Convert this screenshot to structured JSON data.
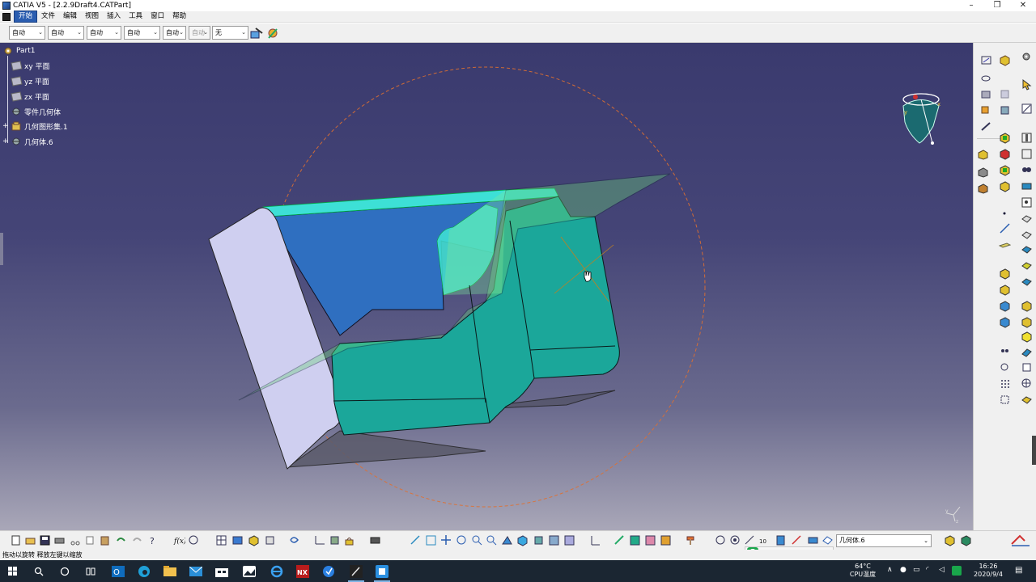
{
  "window": {
    "title": "CATIA V5  - [2.2.9Draft4.CATPart]",
    "controls": [
      "–",
      "❐",
      "✕"
    ]
  },
  "menu": {
    "items": [
      "开始",
      "文件",
      "编辑",
      "视图",
      "插入",
      "工具",
      "窗口",
      "帮助"
    ],
    "active_index": 0
  },
  "properties_toolbar": {
    "combos": [
      "自动",
      "自动",
      "自动",
      "自动",
      "自动",
      "自动",
      "无"
    ]
  },
  "tree": {
    "root": "Part1",
    "items": [
      {
        "label": "xy 平面",
        "icon": "plane-icon"
      },
      {
        "label": "yz 平面",
        "icon": "plane-icon"
      },
      {
        "label": "zx 平面",
        "icon": "plane-icon"
      },
      {
        "label": "零件几何体",
        "icon": "part-body-icon"
      },
      {
        "label": "几何图形集.1",
        "icon": "geometrical-set-icon"
      },
      {
        "label": "几何体.6",
        "icon": "body-icon"
      }
    ]
  },
  "selection": {
    "current_body": "几何体.6"
  },
  "status": {
    "message": "拖动以旋转 释放左键以缩放"
  },
  "ime": {
    "label": "五"
  },
  "taskbar": {
    "temperature": "64°C",
    "temperature_label": "CPU温度",
    "time": "16:26",
    "date": "2020/9/4"
  },
  "colors": {
    "viewport_top": "#3a3a6e",
    "viewport_bottom": "#a9a7b8",
    "solid_teal": "#1ba79a",
    "cyan_fillet": "#3de0d6",
    "lavender_face": "#cfcff0",
    "inner_blue": "#2f6fc0",
    "compass_sphere": "#e07030",
    "menu_highlight": "#2a5db0",
    "taskbar": "#1b2632"
  }
}
